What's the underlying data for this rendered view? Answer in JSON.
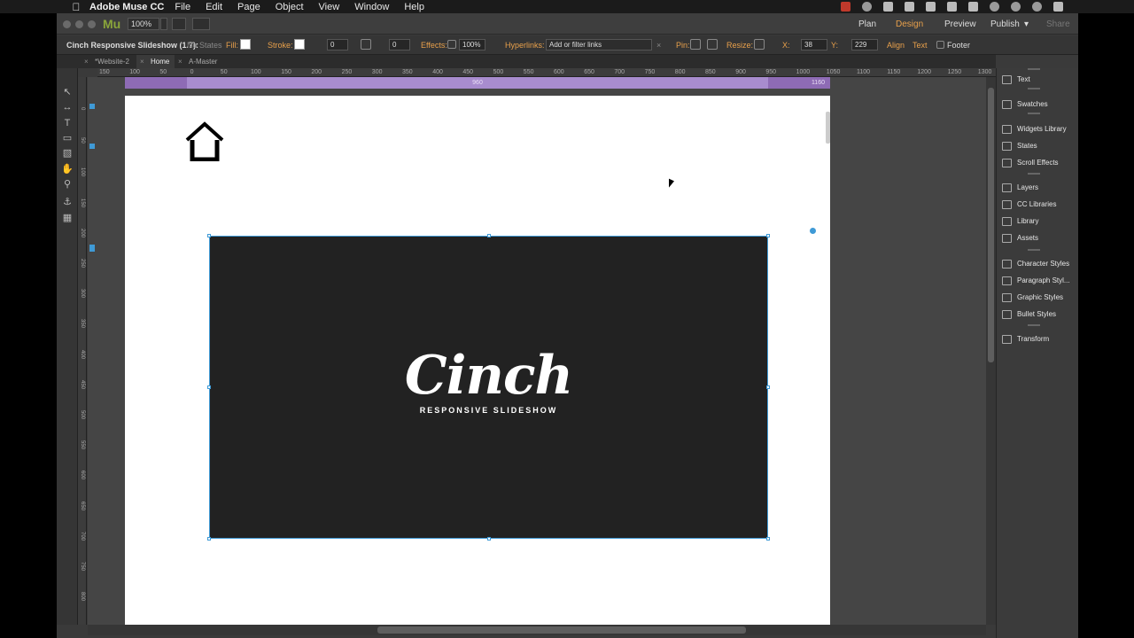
{
  "menubar": {
    "app_name": "Adobe Muse CC",
    "items": [
      "File",
      "Edit",
      "Page",
      "Object",
      "View",
      "Window",
      "Help"
    ]
  },
  "appbar": {
    "logo": "Mu",
    "zoom": "100%",
    "modes": [
      "Plan",
      "Design",
      "Preview",
      "Publish",
      "Share"
    ],
    "active_mode": "Design"
  },
  "controlbar": {
    "selection_label": "Cinch Responsive Slideshow (1.7):",
    "states": "No States",
    "fill_label": "Fill:",
    "stroke_label": "Stroke:",
    "stroke_value": "0",
    "corner_value": "0",
    "effects_label": "Effects:",
    "opacity": "100%",
    "hyperlinks_label": "Hyperlinks:",
    "hyperlinks_placeholder": "Add or filter links",
    "pin_label": "Pin:",
    "resize_label": "Resize:",
    "x_label": "X:",
    "x_value": "38",
    "y_label": "Y:",
    "y_value": "229",
    "align_label": "Align",
    "text_label": "Text",
    "footer_label": "Footer"
  },
  "tabs": [
    {
      "label": "*Website-2"
    },
    {
      "label": "Home"
    },
    {
      "label": "A-Master"
    }
  ],
  "active_tab": "Home",
  "ruler_h": [
    "150",
    "100",
    "50",
    "0",
    "50",
    "100",
    "150",
    "200",
    "250",
    "300",
    "350",
    "400",
    "450",
    "500",
    "550",
    "600",
    "650",
    "700",
    "750",
    "800",
    "850",
    "900",
    "950",
    "1000",
    "1050",
    "1100",
    "1150",
    "1200",
    "1250",
    "1300"
  ],
  "ruler_v": [
    "0",
    "50",
    "100",
    "150",
    "200",
    "250",
    "300",
    "350",
    "400",
    "450",
    "500",
    "550",
    "600",
    "650",
    "700",
    "750",
    "800"
  ],
  "breakpoints": {
    "main": "960",
    "right": "1160"
  },
  "slideshow": {
    "title": "Cinch",
    "subtitle": "RESPONSIVE SLIDESHOW",
    "background": "#222222",
    "selection_color": "#3f9ad6"
  },
  "panels": [
    {
      "label": "Text",
      "icon": "text-icon"
    },
    {
      "label": "Swatches",
      "icon": "swatches-icon"
    },
    {
      "label": "Widgets Library",
      "icon": "widgets-icon"
    },
    {
      "label": "States",
      "icon": "states-icon"
    },
    {
      "label": "Scroll Effects",
      "icon": "scroll-effects-icon"
    },
    {
      "label": "Layers",
      "icon": "layers-icon"
    },
    {
      "label": "CC Libraries",
      "icon": "cc-libraries-icon"
    },
    {
      "label": "Library",
      "icon": "library-icon"
    },
    {
      "label": "Assets",
      "icon": "assets-icon"
    },
    {
      "label": "Character Styles",
      "icon": "character-styles-icon"
    },
    {
      "label": "Paragraph Styl...",
      "icon": "paragraph-styles-icon"
    },
    {
      "label": "Graphic Styles",
      "icon": "graphic-styles-icon"
    },
    {
      "label": "Bullet Styles",
      "icon": "bullet-styles-icon"
    },
    {
      "label": "Transform",
      "icon": "transform-icon"
    }
  ],
  "colors": {
    "accent": "#e8a04b",
    "breakpoint_bar": "#8e6bb5"
  }
}
